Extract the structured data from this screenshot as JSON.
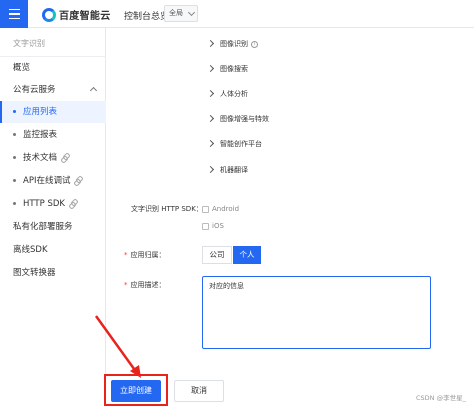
{
  "header": {
    "logo_text": "百度智能云",
    "console_link": "控制台总览",
    "region_select": "全局"
  },
  "sidebar": {
    "title": "文字识别",
    "items": [
      {
        "label": "概览"
      },
      {
        "label": "公有云服务"
      },
      {
        "label": "应用列表"
      },
      {
        "label": "监控报表"
      },
      {
        "label": "技术文档"
      },
      {
        "label": "API在线调试"
      },
      {
        "label": "HTTP SDK"
      },
      {
        "label": "私有化部署服务"
      },
      {
        "label": "离线SDK"
      },
      {
        "label": "图文转换器"
      }
    ]
  },
  "tree": {
    "items": [
      {
        "label": "图像识别"
      },
      {
        "label": "图像搜索"
      },
      {
        "label": "人体分析"
      },
      {
        "label": "图像增强与特效"
      },
      {
        "label": "智能创作平台"
      },
      {
        "label": "机器翻译"
      }
    ]
  },
  "form": {
    "sdk_label": "文字识别 HTTP SDK：",
    "sdk_options": [
      {
        "label": "Android",
        "checked": false
      },
      {
        "label": "iOS",
        "checked": false
      }
    ],
    "owner_label": "应用归属：",
    "owner_options": [
      {
        "label": "公司",
        "selected": false
      },
      {
        "label": "个人",
        "selected": true
      }
    ],
    "description_label": "应用描述：",
    "description_value": "对应的信息"
  },
  "actions": {
    "create_label": "立即创建",
    "cancel_label": "取消"
  },
  "watermark": "CSDN @李世星_",
  "colors": {
    "brand_blue": "#2468f2",
    "annotation_red": "#e8231b"
  }
}
